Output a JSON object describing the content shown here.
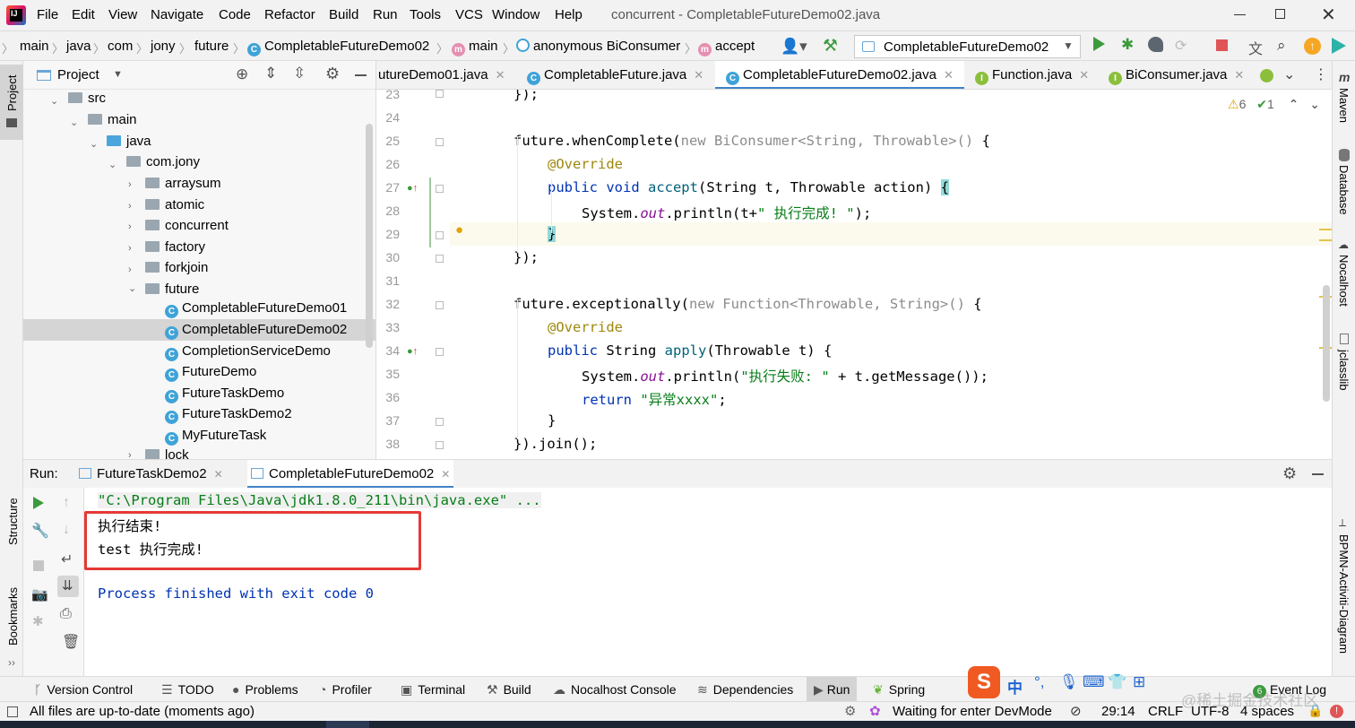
{
  "menu": {
    "items": [
      "File",
      "Edit",
      "View",
      "Navigate",
      "Code",
      "Refactor",
      "Build",
      "Run",
      "Tools",
      "VCS",
      "Window",
      "Help"
    ],
    "window_title": "concurrent - CompletableFutureDemo02.java"
  },
  "breadcrumb": {
    "items": [
      "main",
      "java",
      "com",
      "jony",
      "future",
      "CompletableFutureDemo02",
      "main",
      "anonymous BiConsumer",
      "accept"
    ],
    "run_config": "CompletableFutureDemo02"
  },
  "left_strip": {
    "top": "Project",
    "middle": "Structure",
    "bottom": "Bookmarks"
  },
  "right_strip": {
    "items": [
      "Maven",
      "Database",
      "Nocalhost",
      "jclasslib",
      "BPMN-Activiti-Diagram"
    ]
  },
  "project": {
    "title": "Project",
    "tree": [
      {
        "label": "src",
        "type": "folder"
      },
      {
        "label": "main",
        "type": "folder"
      },
      {
        "label": "java",
        "type": "folder-blue"
      },
      {
        "label": "com.jony",
        "type": "package"
      },
      {
        "label": "arraysum",
        "type": "package"
      },
      {
        "label": "atomic",
        "type": "package"
      },
      {
        "label": "concurrent",
        "type": "package"
      },
      {
        "label": "factory",
        "type": "package"
      },
      {
        "label": "forkjoin",
        "type": "package"
      },
      {
        "label": "future",
        "type": "package"
      },
      {
        "label": "CompletableFutureDemo01",
        "type": "class"
      },
      {
        "label": "CompletableFutureDemo02",
        "type": "class"
      },
      {
        "label": "CompletionServiceDemo",
        "type": "class"
      },
      {
        "label": "FutureDemo",
        "type": "class"
      },
      {
        "label": "FutureTaskDemo",
        "type": "class"
      },
      {
        "label": "FutureTaskDemo2",
        "type": "class"
      },
      {
        "label": "MyFutureTask",
        "type": "class"
      },
      {
        "label": "lock",
        "type": "package"
      }
    ]
  },
  "tabs": [
    {
      "label": "utureDemo01.java",
      "icon": "class"
    },
    {
      "label": "CompletableFuture.java",
      "icon": "class"
    },
    {
      "label": "CompletableFutureDemo02.java",
      "icon": "class"
    },
    {
      "label": "Function.java",
      "icon": "interface"
    },
    {
      "label": "BiConsumer.java",
      "icon": "interface"
    }
  ],
  "inspections": {
    "warnings": "6",
    "ok": "1"
  },
  "code": {
    "line_numbers": [
      "23",
      "24",
      "25",
      "26",
      "27",
      "28",
      "29",
      "30",
      "31",
      "32",
      "33",
      "34",
      "35",
      "36",
      "37",
      "38"
    ],
    "l23": "});",
    "l25_a": "future.whenComplete(",
    "l25_b": "new BiConsumer<String, Throwable>()",
    "l25_c": " {",
    "l26": "@Override",
    "l27_a": "public void ",
    "l27_b": "accept",
    "l27_c": "(String t, Throwable action) ",
    "l27_d": "{",
    "l28_a": "System.",
    "l28_b": "out",
    "l28_c": ".println(t+",
    "l28_d": "\" 执行完成! \"",
    "l28_e": ");",
    "l29": "}",
    "l30": "});",
    "l32_a": "future.exceptionally(",
    "l32_b": "new Function<Throwable, String>()",
    "l32_c": " {",
    "l33": "@Override",
    "l34_a": "public ",
    "l34_b": "String ",
    "l34_c": "apply",
    "l34_d": "(Throwable t) {",
    "l35_a": "System.",
    "l35_b": "out",
    "l35_c": ".println(",
    "l35_d": "\"执行失败: \"",
    "l35_e": " + t.getMessage());",
    "l36_a": "return ",
    "l36_b": "\"异常xxxx\"",
    "l36_c": ";",
    "l37": "}",
    "l38": "}).join();"
  },
  "run": {
    "label": "Run:",
    "tabs": [
      "FutureTaskDemo2",
      "CompletableFutureDemo02"
    ],
    "output": {
      "cmd": "\"C:\\Program Files\\Java\\jdk1.8.0_211\\bin\\java.exe\" ...",
      "line1": "执行结束!",
      "line2": "test 执行完成!",
      "exit": "Process finished with exit code 0"
    },
    "highlight_color": "#e53935"
  },
  "tool_windows": [
    "Version Control",
    "TODO",
    "Problems",
    "Profiler",
    "Terminal",
    "Build",
    "Nocalhost Console",
    "Dependencies",
    "Run",
    "Spring",
    "Event Log"
  ],
  "event_log_count": "6",
  "status": {
    "message": "All files are up-to-date (moments ago)",
    "devmode": "Waiting for enter DevMode",
    "position": "29:14",
    "line_sep": "CRLF",
    "encoding": "UTF-8",
    "indent": "4 spaces"
  },
  "ime": {
    "logo": "S",
    "mode": "中"
  },
  "watermark": "@稀土掘金技术社区",
  "colors": {
    "accent": "#4083c9",
    "run_green": "#3c9a3c",
    "stop_red": "#e05555",
    "warning": "#e2a300"
  }
}
